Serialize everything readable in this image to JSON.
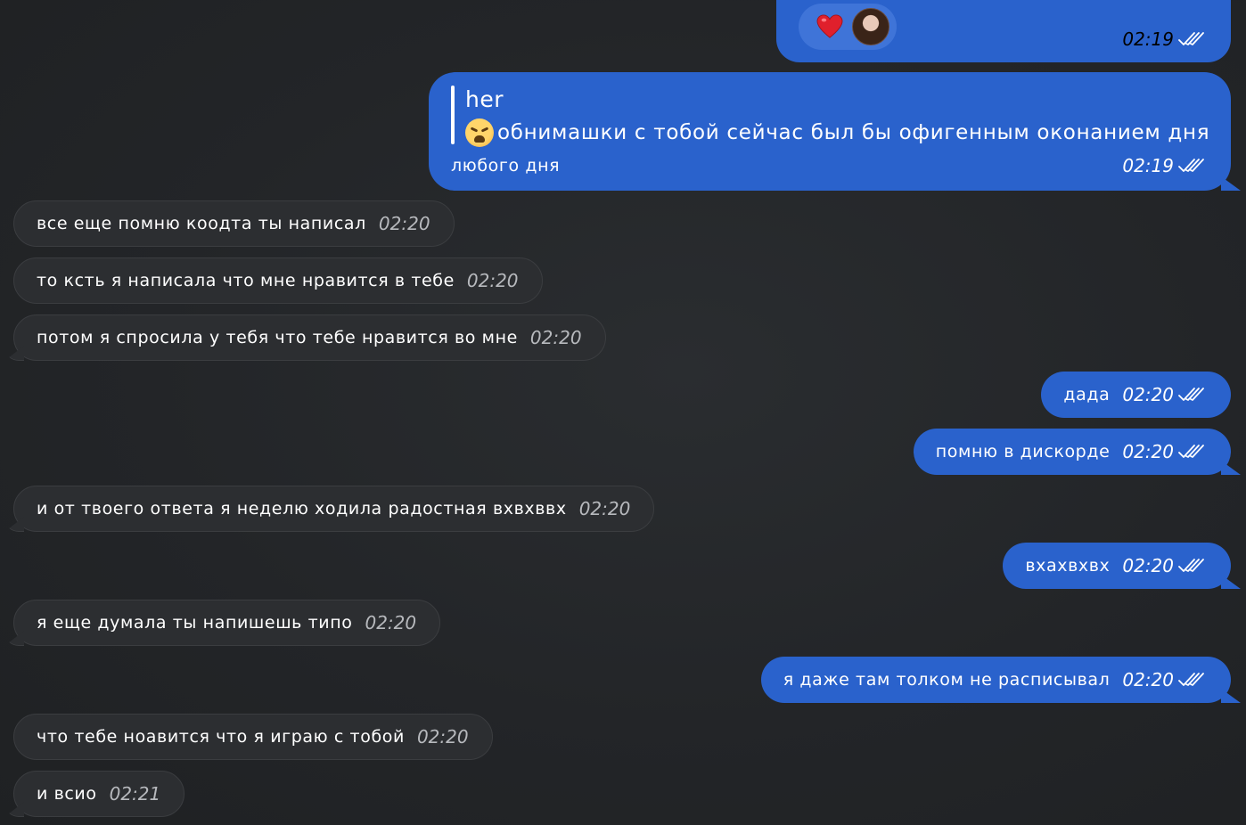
{
  "top_message": {
    "reaction_emoji": "heart",
    "time": "02:19"
  },
  "reply_message": {
    "quote_author": "her",
    "quote_emoji": "weary-face",
    "line1": "обнимашки с тобой сейчас был бы офигенным оконанием дня",
    "line2": "любого дня",
    "time": "02:19"
  },
  "messages": [
    {
      "side": "in",
      "text": "все еще помню коодта ты написал",
      "time": "02:20"
    },
    {
      "side": "in",
      "text": "то кcть я написала что мне нравится в тебе",
      "time": "02:20"
    },
    {
      "side": "in",
      "text": "потом я спросила у тебя что тебе нравится во мне",
      "time": "02:20"
    },
    {
      "side": "out",
      "text": "дада",
      "time": "02:20"
    },
    {
      "side": "out",
      "text": "помню в дискорде",
      "time": "02:20"
    },
    {
      "side": "in",
      "text": "и от твоего ответа я неделю ходила радостная вхвхввх",
      "time": "02:20"
    },
    {
      "side": "out",
      "text": "вхахвхвх",
      "time": "02:20"
    },
    {
      "side": "in",
      "text": "я еще думала ты напишешь типо",
      "time": "02:20"
    },
    {
      "side": "out",
      "text": "я даже там толком не расписывал",
      "time": "02:20"
    },
    {
      "side": "in",
      "text": "что тебе ноавится что я играю с тобой",
      "time": "02:20"
    },
    {
      "side": "in",
      "text": "и всио",
      "time": "02:21"
    }
  ],
  "colors": {
    "background": "#232528",
    "incoming_bubble": "#2c2e31",
    "outgoing_bubble": "#2a62cc",
    "incoming_time": "#b7b9bd"
  },
  "icons": {
    "read_receipt": "double-check-icon",
    "reaction": "heart-icon"
  }
}
